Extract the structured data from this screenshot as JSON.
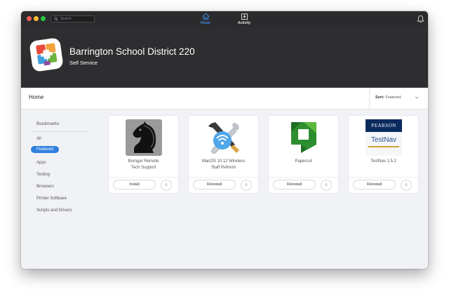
{
  "titlebar": {
    "search_placeholder": "Search",
    "nav": [
      {
        "label": "Home",
        "icon": "home-icon",
        "active": true
      },
      {
        "label": "Activity",
        "icon": "download-tray-icon",
        "active": false
      }
    ],
    "notifications_icon": "bell-icon"
  },
  "header": {
    "org_name": "Barrington School District 220",
    "subtitle": "Self Service",
    "logo_icon": "self-service-logo"
  },
  "subbar": {
    "title": "Home",
    "sort_label": "Sort:",
    "sort_value": "Featured"
  },
  "sidebar": {
    "heading": "Bookmarks",
    "items": [
      {
        "label": "All"
      },
      {
        "label": "Featured",
        "active": true
      },
      {
        "label": "Apps"
      },
      {
        "label": "Testing"
      },
      {
        "label": "Browsers"
      },
      {
        "label": "Printer Software"
      },
      {
        "label": "Scripts and Drivers"
      }
    ]
  },
  "cards": [
    {
      "name_line1": "Bomgar Remote",
      "name_line2": "Tech Support",
      "action": "Install",
      "info": "i",
      "icon": "knight-icon"
    },
    {
      "name_line1": "MacOS 10.12 Wireless",
      "name_line2": "Staff Refresh",
      "action": "Reinstall",
      "info": "i",
      "icon": "wifi-tools-icon"
    },
    {
      "name_line1": "Papercut",
      "name_line2": "",
      "action": "Reinstall",
      "info": "i",
      "icon": "papercut-icon"
    },
    {
      "name_line1": "TestNav 1.5.2",
      "name_line2": "",
      "action": "Reinstall",
      "info": "i",
      "icon": "pearson-testnav-icon",
      "icon_text_top": "PEARSON",
      "icon_text_bottom": "TestNav"
    }
  ],
  "colors": {
    "accent": "#2f80de",
    "titlebar": "#2b2b2d",
    "header": "#2e2e30",
    "content_bg": "#f1f2f6"
  }
}
